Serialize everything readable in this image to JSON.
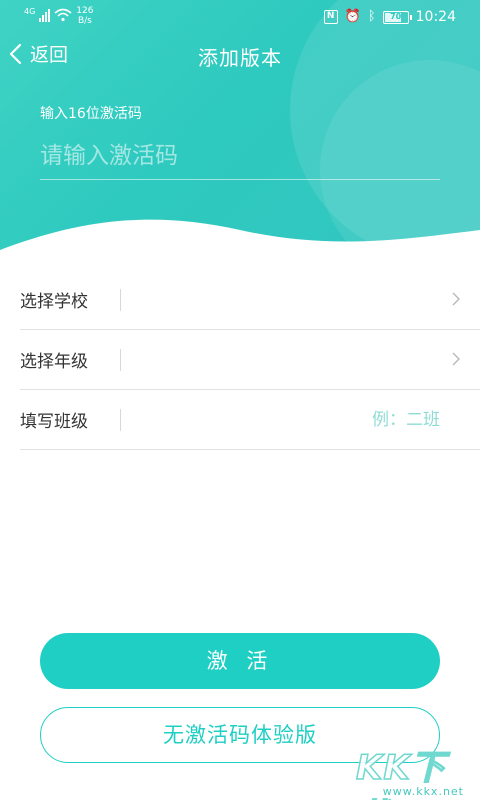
{
  "status_bar": {
    "signal_label": "4G",
    "net_speed_value": "126",
    "net_speed_unit": "B/s",
    "battery_level": "70",
    "time": "10:24"
  },
  "nav": {
    "back_label": "返回",
    "title": "添加版本"
  },
  "activation": {
    "label": "输入16位激活码",
    "placeholder": "请输入激活码"
  },
  "form": {
    "school_label": "选择学校",
    "grade_label": "选择年级",
    "class_label": "填写班级",
    "class_placeholder": "例：二班"
  },
  "buttons": {
    "activate_label": "激 活",
    "trial_label": "无激活码体验版"
  },
  "watermark": {
    "brand": "KK下载",
    "url": "www.kkx.net"
  },
  "colors": {
    "accent": "#1fcfc4",
    "header_gradient_start": "#3fd3c4",
    "header_gradient_end": "#33c6c0"
  }
}
